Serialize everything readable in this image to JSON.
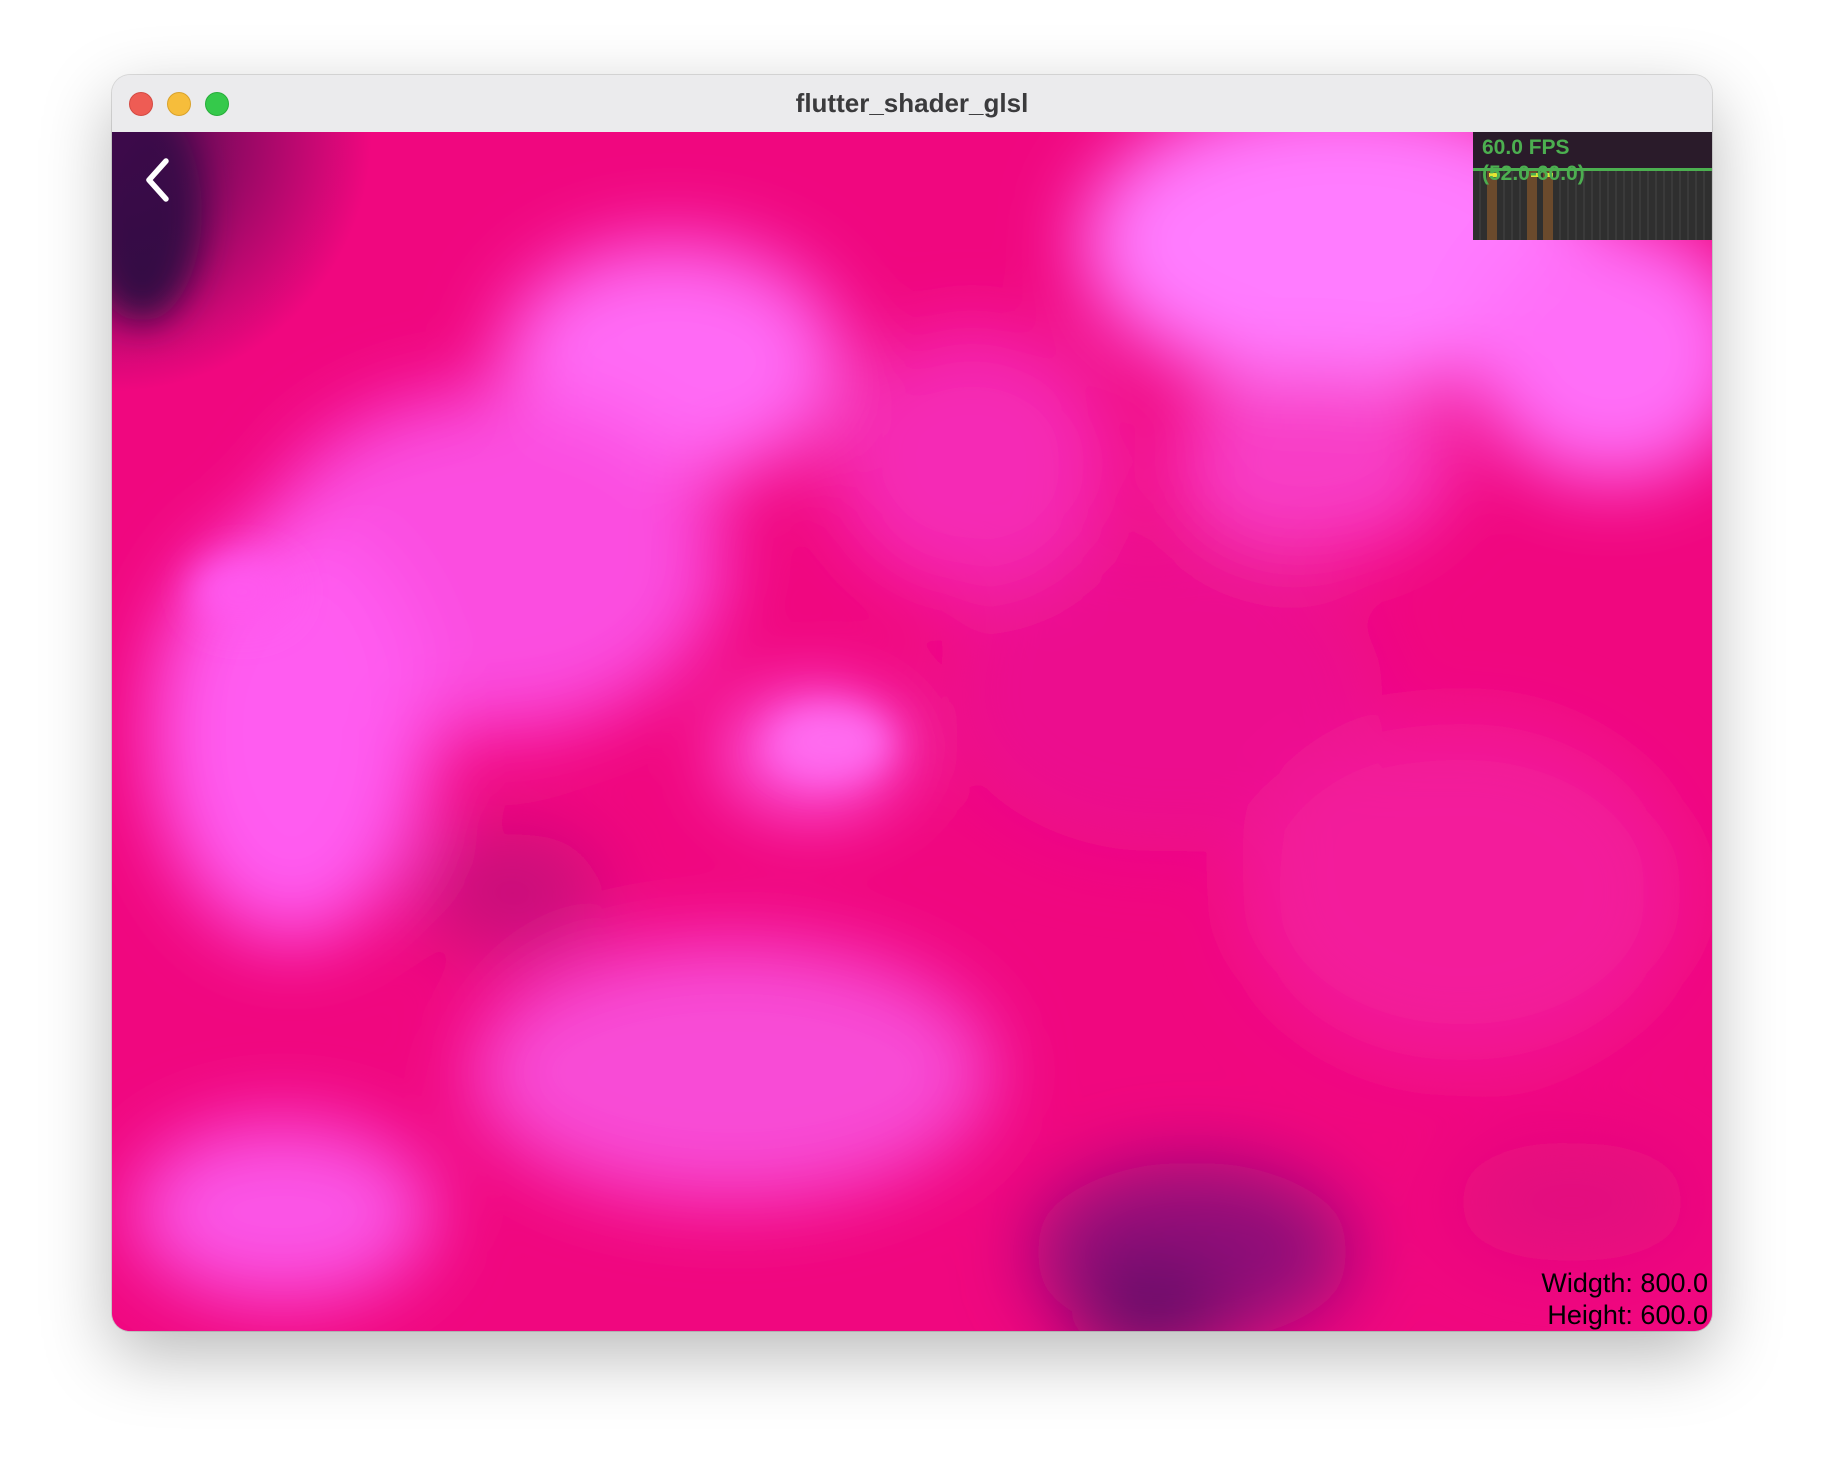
{
  "window": {
    "title": "flutter_shader_glsl"
  },
  "icons": {
    "close": "close-traffic-light",
    "minimize": "minimize-traffic-light",
    "maximize": "maximize-traffic-light",
    "back": "chevron-left-icon"
  },
  "performance_overlay": {
    "fps": "60.0 FPS",
    "range": "(52.0-60.0)"
  },
  "dimensions": {
    "width_label": "Widgth: 800.0",
    "height_label": "Height: 600.0"
  },
  "colors": {
    "shader_base": "#f0077f",
    "shader_light": "#ff77ff",
    "shader_dark": "#5a0a66",
    "fps_text": "#4caf50"
  }
}
